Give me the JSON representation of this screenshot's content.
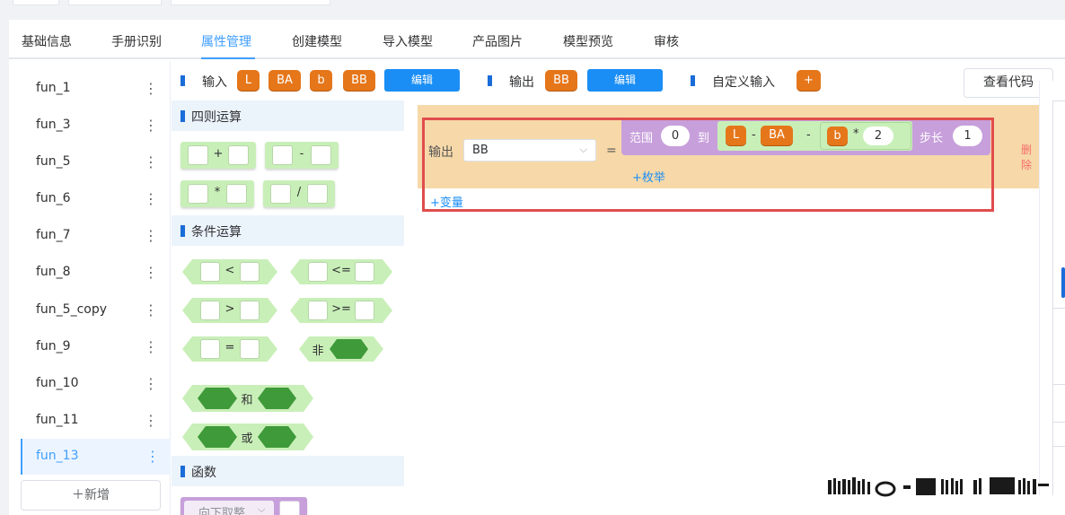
{
  "tabs": [
    {
      "label": "基础信息",
      "active": false
    },
    {
      "label": "手册识别",
      "active": false
    },
    {
      "label": "属性管理",
      "active": true
    },
    {
      "label": "创建模型",
      "active": false
    },
    {
      "label": "导入模型",
      "active": false
    },
    {
      "label": "产品图片",
      "active": false
    },
    {
      "label": "模型预览",
      "active": false
    },
    {
      "label": "审核",
      "active": false
    }
  ],
  "sidebar": {
    "items": [
      {
        "label": "fun_1",
        "active": false
      },
      {
        "label": "fun_3",
        "active": false
      },
      {
        "label": "fun_5",
        "active": false
      },
      {
        "label": "fun_6",
        "active": false
      },
      {
        "label": "fun_7",
        "active": false
      },
      {
        "label": "fun_8",
        "active": false
      },
      {
        "label": "fun_5_copy",
        "active": false
      },
      {
        "label": "fun_9",
        "active": false
      },
      {
        "label": "fun_10",
        "active": false
      },
      {
        "label": "fun_11",
        "active": false
      },
      {
        "label": "fun_13",
        "active": true
      }
    ],
    "more_icon": "⋮",
    "add_label": "＋新增"
  },
  "toolbar": {
    "input_label": "输入",
    "input_vars": [
      "L",
      "BA",
      "b",
      "BB"
    ],
    "edit_label": "编辑",
    "output_label": "输出",
    "output_vars": [
      "BB"
    ],
    "custom_input_label": "自定义输入",
    "add_symbol": "+",
    "view_code_label": "查看代码"
  },
  "palette": {
    "arith": {
      "title": "四则运算",
      "ops": [
        "+",
        "-",
        "*",
        "/"
      ]
    },
    "cond": {
      "title": "条件运算",
      "ops": [
        "<",
        "<=",
        ">",
        ">=",
        "=",
        "非",
        "和",
        "或"
      ]
    },
    "func": {
      "title": "函数",
      "floor_label": "向下取整"
    }
  },
  "canvas": {
    "output_label": "输出",
    "output_value": "BB",
    "equals": "=",
    "range_label": "范围",
    "from": "0",
    "to_label": "到",
    "expr": {
      "v1": "L",
      "minus": "-",
      "v2": "BA",
      "v3": "b",
      "times": "*",
      "num": "2"
    },
    "step_label": "步长",
    "step": "1",
    "enum_link": "+枚举",
    "delete_link": "删除",
    "var_link": "+变量"
  },
  "colors": {
    "accent": "#409eff",
    "variable_chip": "#e6761a",
    "edit_button": "#1a8ef5",
    "block_green": "#c9efb8",
    "hex_dark": "#3f9a3a",
    "range_purple": "#c79fdb",
    "row_orange": "#f7d9a9",
    "highlight_red": "#e04d4d"
  }
}
